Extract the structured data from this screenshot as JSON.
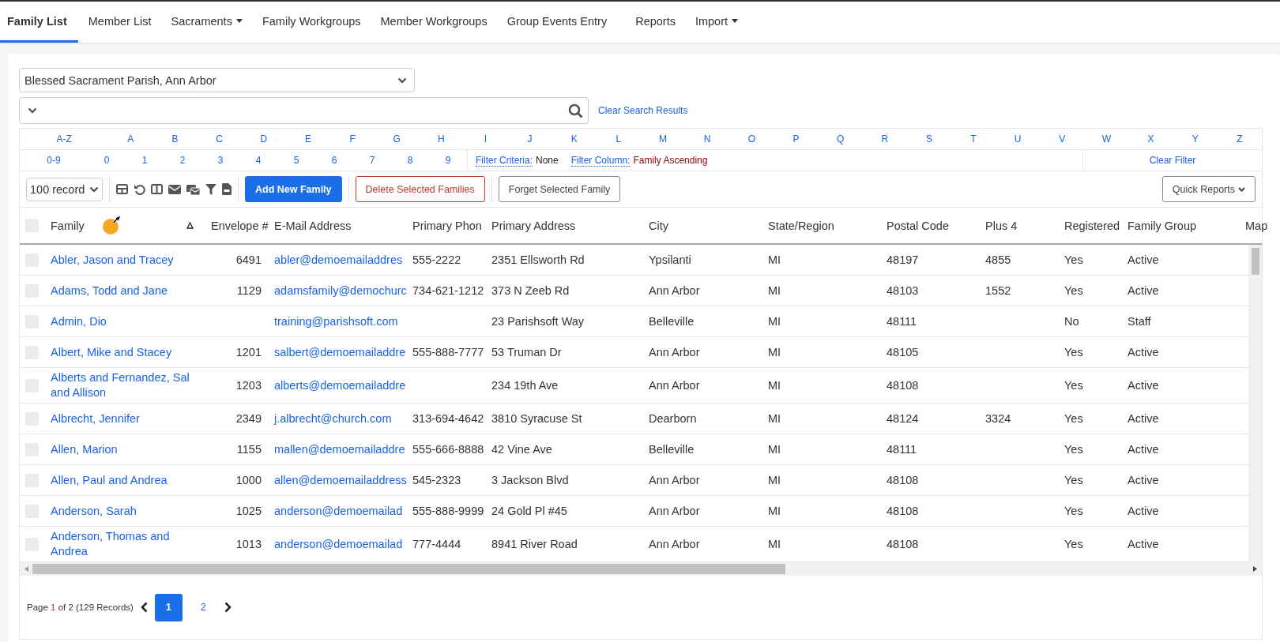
{
  "tabs": [
    {
      "label": "Family List",
      "selected": true,
      "dropdown": false
    },
    {
      "label": "Member List",
      "selected": false,
      "dropdown": false
    },
    {
      "label": "Sacraments",
      "selected": false,
      "dropdown": true
    },
    {
      "label": "Family Workgroups",
      "selected": false,
      "dropdown": false
    },
    {
      "label": "Member Workgroups",
      "selected": false,
      "dropdown": false
    },
    {
      "label": "Group Events Entry",
      "selected": false,
      "dropdown": false
    },
    {
      "label": "Reports",
      "selected": false,
      "dropdown": false
    },
    {
      "label": "Import",
      "selected": false,
      "dropdown": true
    }
  ],
  "parish_select": {
    "value": "Blessed Sacrament Parish, Ann Arbor"
  },
  "search": {
    "clear_link": "Clear Search Results"
  },
  "letters": [
    "A-Z",
    "A",
    "B",
    "C",
    "D",
    "E",
    "F",
    "G",
    "H",
    "I",
    "J",
    "K",
    "L",
    "M",
    "N",
    "O",
    "P",
    "Q",
    "R",
    "S",
    "T",
    "U",
    "V",
    "W",
    "X",
    "Y",
    "Z"
  ],
  "digits": [
    "0-9",
    "0",
    "1",
    "2",
    "3",
    "4",
    "5",
    "6",
    "7",
    "8",
    "9"
  ],
  "filter_criteria": {
    "label": "Filter Criteria:",
    "value": "None"
  },
  "filter_column": {
    "label": "Filter Column:",
    "value": "Family Ascending"
  },
  "clear_filter": "Clear Filter",
  "toolbar": {
    "page_size": "100 record",
    "add_button": "Add New Family",
    "delete_button": "Delete Selected Families",
    "forget_button": "Forget Selected Family",
    "quick_reports": "Quick Reports"
  },
  "table": {
    "select_all": {
      "checked": false
    },
    "columns": [
      {
        "label": "Family",
        "sorted": true
      },
      {
        "label": "Envelope #"
      },
      {
        "label": "E-Mail Address"
      },
      {
        "label": "Primary Phon"
      },
      {
        "label": "Primary Address"
      },
      {
        "label": "City"
      },
      {
        "label": "State/Region"
      },
      {
        "label": "Postal Code"
      },
      {
        "label": "Plus 4"
      },
      {
        "label": "Registered"
      },
      {
        "label": "Family Group"
      },
      {
        "label": "Map"
      }
    ],
    "rows": [
      {
        "checked": false,
        "cells": [
          "Abler, Jason and Tracey",
          "6491",
          "abler@demoemailaddres",
          "555-2222",
          "2351 Ellsworth Rd",
          "Ypsilanti",
          "MI",
          "48197",
          "4855",
          "Yes",
          "Active"
        ]
      },
      {
        "checked": false,
        "cells": [
          "Adams, Todd and Jane",
          "1129",
          "adamsfamily@demochurc",
          "734-621-1212",
          "373 N Zeeb Rd",
          "Ann Arbor",
          "MI",
          "48103",
          "1552",
          "Yes",
          "Active"
        ]
      },
      {
        "checked": false,
        "cells": [
          "Admin, Dio",
          "",
          "training@parishsoft.com",
          "",
          "23 Parishsoft Way",
          "Belleville",
          "MI",
          "48111",
          "",
          "No",
          "Staff"
        ]
      },
      {
        "checked": false,
        "cells": [
          "Albert, Mike and Stacey",
          "1201",
          "salbert@demoemailaddre",
          "555-888-7777",
          "53 Truman Dr",
          "Ann Arbor",
          "MI",
          "48105",
          "",
          "Yes",
          "Active"
        ]
      },
      {
        "checked": false,
        "cells": [
          "Alberts and Fernandez, Sal and Allison",
          "1203",
          "alberts@demoemailaddre",
          "",
          "234 19th Ave",
          "Ann Arbor",
          "MI",
          "48108",
          "",
          "Yes",
          "Active"
        ]
      },
      {
        "checked": false,
        "cells": [
          "Albrecht, Jennifer",
          "2349",
          "j.albrecht@church.com",
          "313-694-4642",
          "3810 Syracuse St",
          "Dearborn",
          "MI",
          "48124",
          "3324",
          "Yes",
          "Active"
        ]
      },
      {
        "checked": false,
        "cells": [
          "Allen, Marion",
          "1155",
          "mallen@demoemailaddre",
          "555-666-8888",
          "42 Vine Ave",
          "Belleville",
          "MI",
          "48111",
          "",
          "Yes",
          "Active"
        ]
      },
      {
        "checked": false,
        "cells": [
          "Allen, Paul and Andrea",
          "1000",
          "allen@demoemailaddress",
          "545-2323",
          "3 Jackson Blvd",
          "Ann Arbor",
          "MI",
          "48108",
          "",
          "Yes",
          "Active"
        ]
      },
      {
        "checked": false,
        "cells": [
          "Anderson, Sarah",
          "1025",
          "anderson@demoemailad",
          "555-888-9999",
          "24 Gold Pl #45",
          "Ann Arbor",
          "MI",
          "48108",
          "",
          "Yes",
          "Active"
        ]
      },
      {
        "checked": false,
        "cells": [
          "Anderson, Thomas and Andrea",
          "1013",
          "anderson@demoemailad",
          "777-4444",
          "8941 River Road",
          "Ann Arbor",
          "MI",
          "48108",
          "",
          "Yes",
          "Active"
        ]
      }
    ]
  },
  "pager": {
    "before": "Page",
    "current": "1",
    "after": "of 2 (129 Records)",
    "pages": [
      {
        "label": "1",
        "selected": true
      },
      {
        "label": "2",
        "selected": false
      }
    ]
  }
}
